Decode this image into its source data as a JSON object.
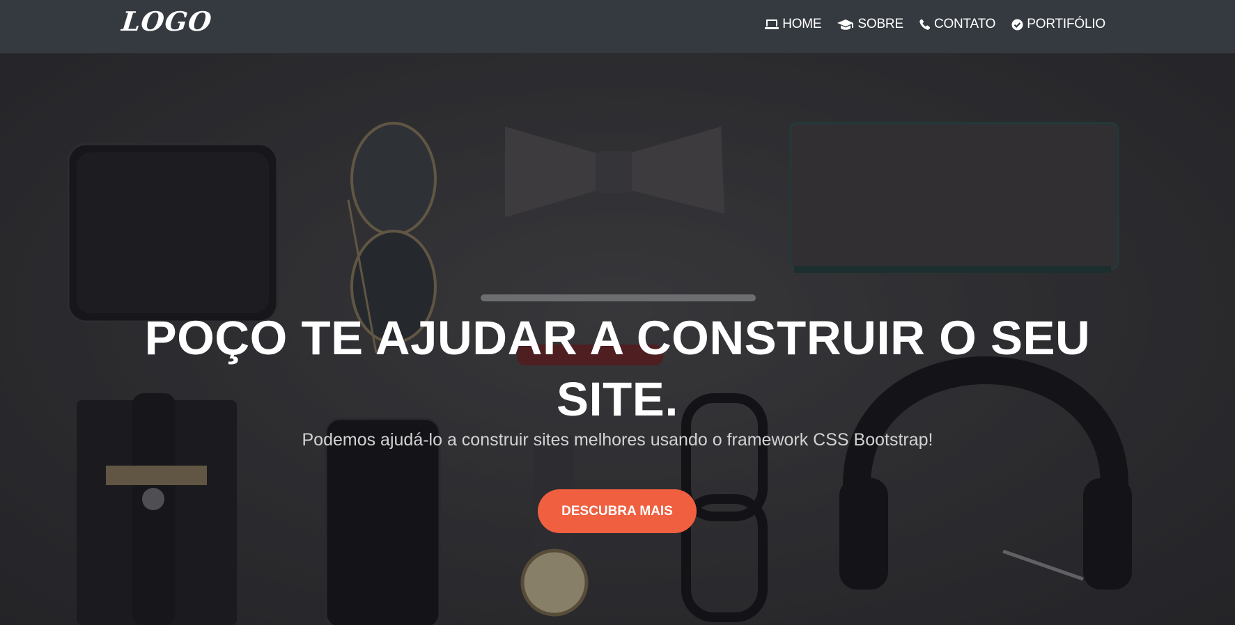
{
  "brand": {
    "logo_text": "LOGO"
  },
  "nav": {
    "items": [
      {
        "label": "HOME",
        "icon": "laptop-icon"
      },
      {
        "label": "SOBRE",
        "icon": "graduation-cap-icon"
      },
      {
        "label": "CONTATO",
        "icon": "phone-icon"
      },
      {
        "label": "PORTIFÓLIO",
        "icon": "check-circle-icon"
      }
    ]
  },
  "hero": {
    "headline": "POÇO TE AJUDAR A CONSTRUIR O SEU SITE.",
    "subtitle": "Podemos ajudá-lo a construir sites melhores usando o framework CSS Bootstrap!",
    "cta_label": "DESCUBRA MAIS"
  },
  "colors": {
    "navbar_bg": "#343a40",
    "accent": "#f05f40",
    "text": "#ffffff"
  }
}
